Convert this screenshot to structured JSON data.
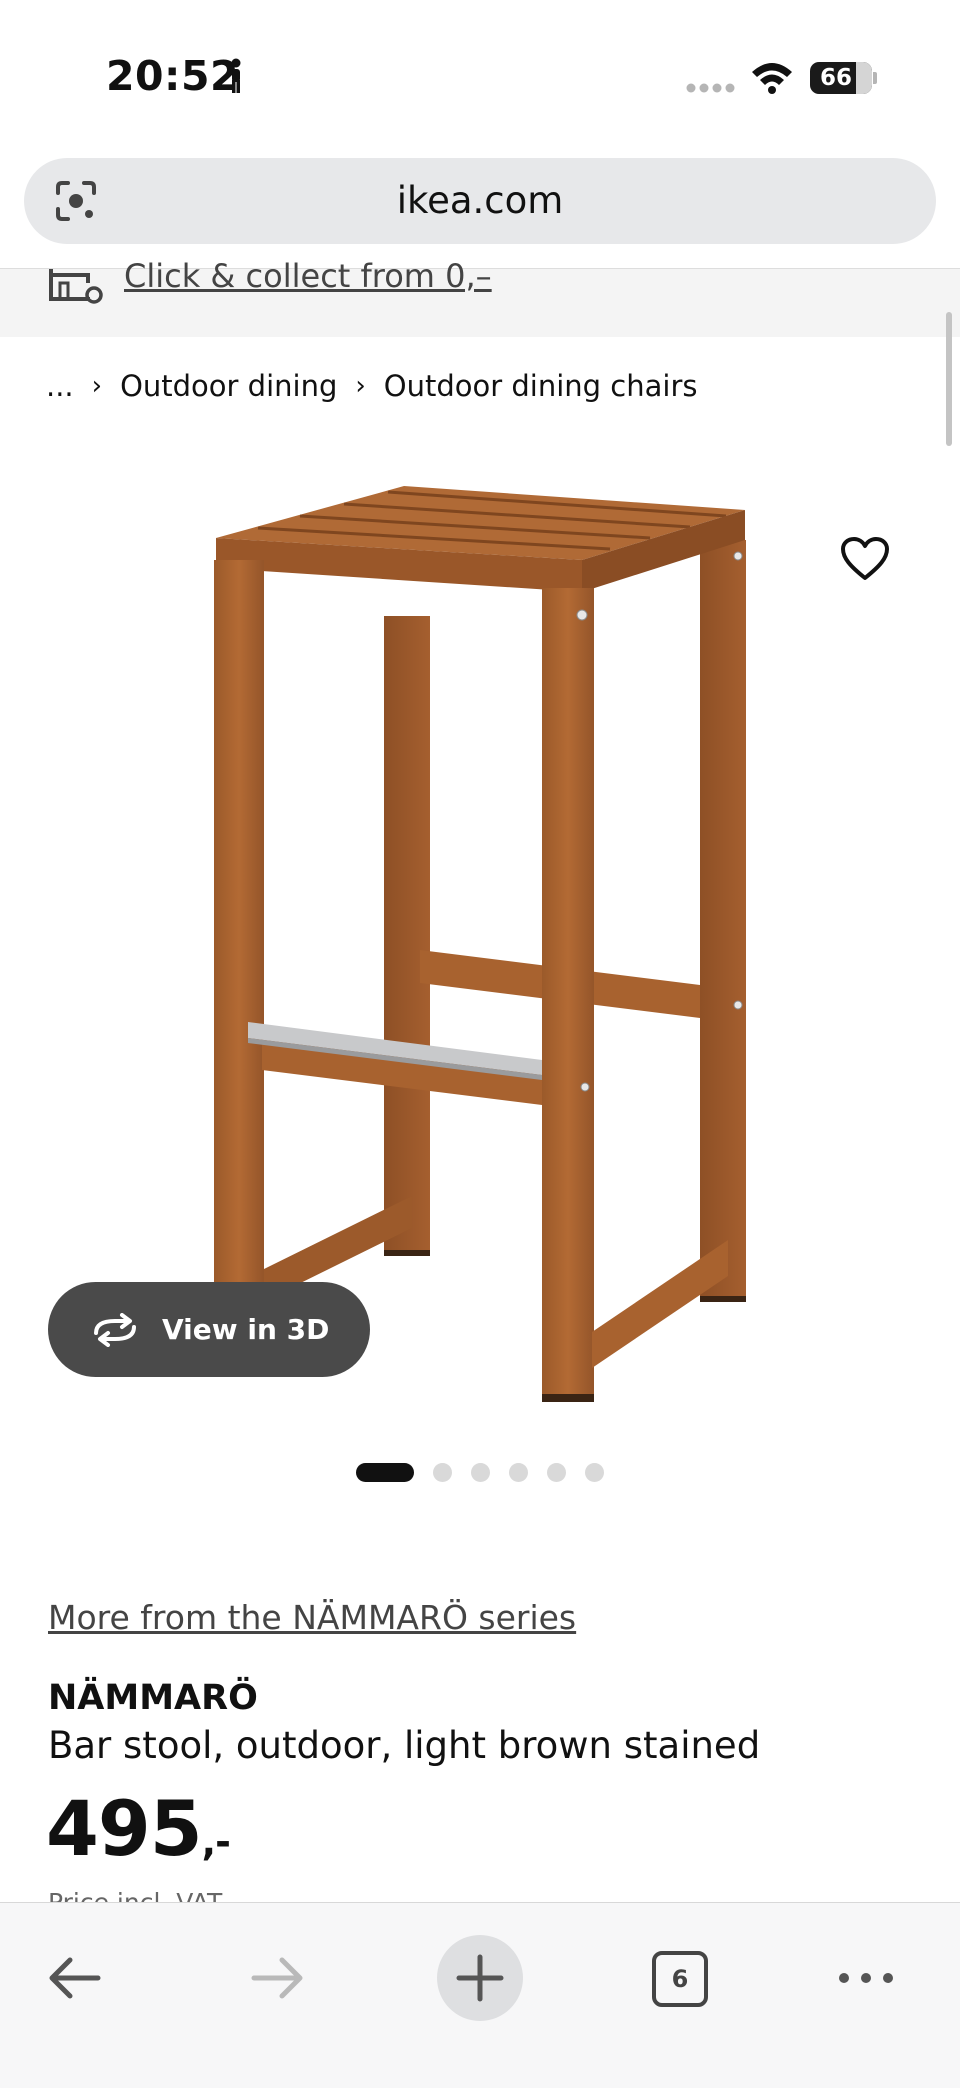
{
  "status_bar": {
    "time": "20:52",
    "battery_percent": "66",
    "icons": [
      "person-walking-icon",
      "signal-dots-icon",
      "wifi-icon",
      "battery-icon"
    ]
  },
  "browser": {
    "url": "ikea.com",
    "icons": [
      "lens-search-icon"
    ]
  },
  "banner": {
    "text": "Click & collect from 0,–",
    "icon": "store-icon"
  },
  "breadcrumb": {
    "items": [
      "...",
      "Outdoor dining",
      "Outdoor dining chairs"
    ],
    "separator": "›"
  },
  "gallery": {
    "view_3d_label": "View in 3D",
    "image_count": 6,
    "active_index": 0,
    "icons": [
      "heart-icon",
      "rotate-3d-icon"
    ]
  },
  "product": {
    "series_link": "More from the NÄMMARÖ series",
    "name": "NÄMMARÖ",
    "description": "Bar stool, outdoor, light brown stained",
    "price": "495",
    "price_suffix": ",-",
    "vat_note": "Price incl. VAT"
  },
  "toolbar": {
    "tab_count": "6",
    "icons": [
      "back-arrow-icon",
      "forward-arrow-icon",
      "plus-icon",
      "tabs-icon",
      "more-icon"
    ]
  },
  "colors": {
    "wood": "#a8622f",
    "wood_dark": "#8a4e24",
    "pill": "#4a4a4a",
    "address_bar": "#e7e8ea"
  }
}
